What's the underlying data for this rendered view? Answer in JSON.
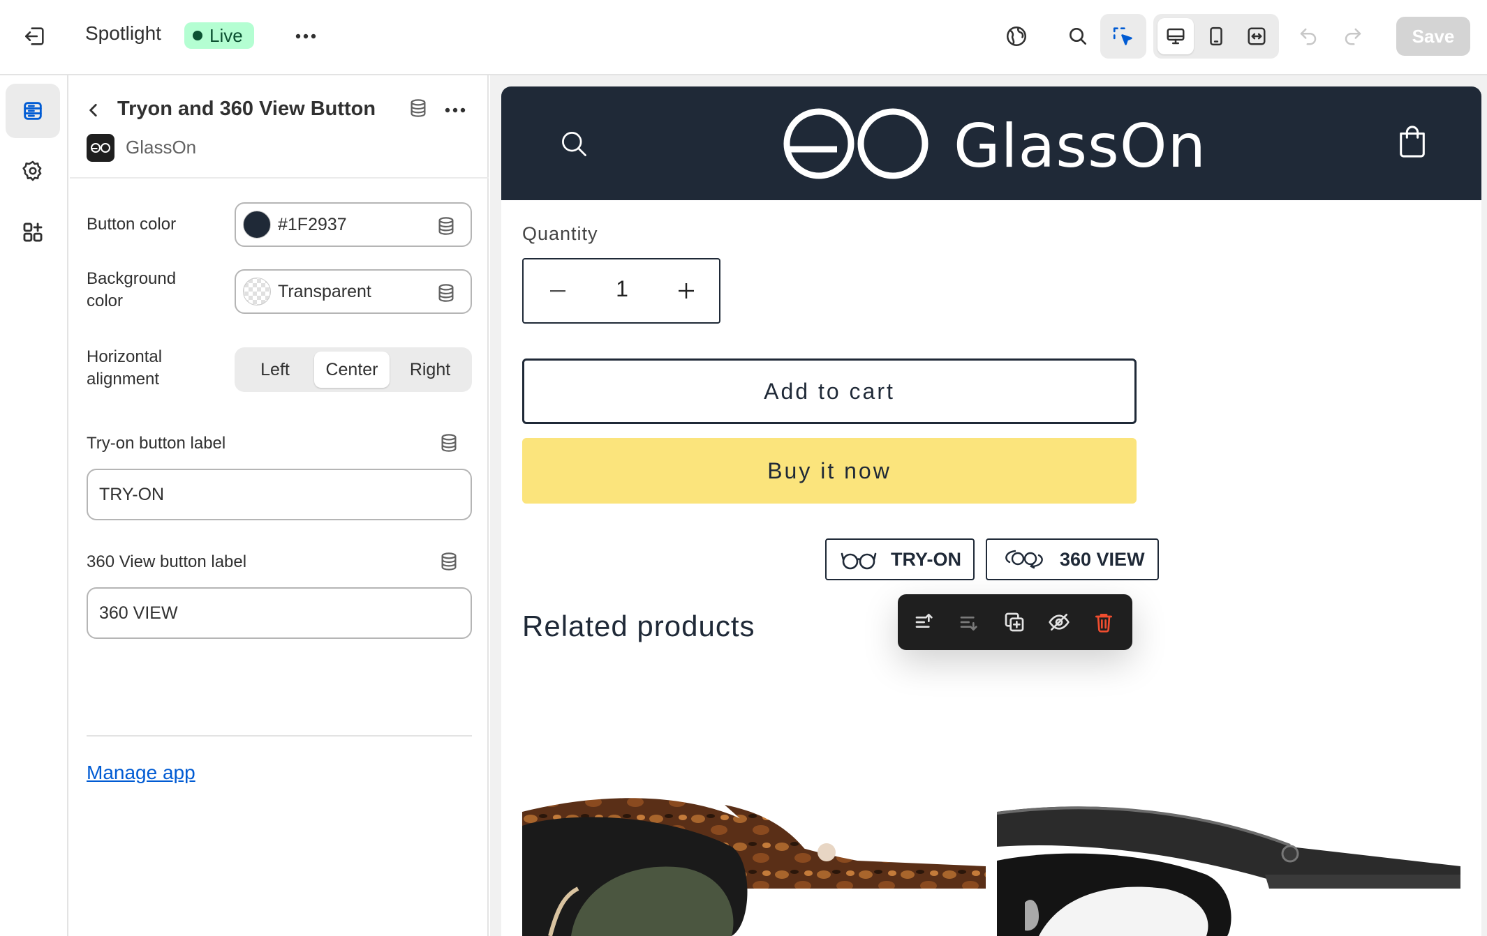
{
  "topbar": {
    "theme_name": "Spotlight",
    "status": "Live",
    "save_label": "Save",
    "colors": {
      "live_bg": "#b4fed2",
      "live_fg": "#0c5132",
      "save_bg": "#d4d4d4"
    }
  },
  "panel": {
    "block_title": "Tryon and 360 View Button",
    "app_name": "GlassOn",
    "button_color": {
      "label": "Button color",
      "value": "#1F2937"
    },
    "background_color": {
      "label": "Background color",
      "value": "Transparent"
    },
    "alignment": {
      "label": "Horizontal alignment",
      "options": [
        "Left",
        "Center",
        "Right"
      ],
      "selected": "Center"
    },
    "tryon_label": {
      "label": "Try-on button label",
      "value": "TRY-ON"
    },
    "view_label": {
      "label": "360 View button label",
      "value": "360 VIEW"
    },
    "manage_link": "Manage app"
  },
  "store": {
    "brand": "GlassOn",
    "quantity_label": "Quantity",
    "quantity": "1",
    "add_to_cart": "Add to cart",
    "buy_now": "Buy it now",
    "tryon_button": "TRY-ON",
    "view_button": "360 VIEW",
    "related": "Related products",
    "colors": {
      "header_bg": "#1F2937",
      "buy_now_bg": "#fbe47c"
    }
  },
  "icons": [
    "exit-icon",
    "more-icon",
    "globe-icon",
    "search-icon",
    "select-icon",
    "desktop-icon",
    "mobile-icon",
    "fullscreen-icon",
    "undo-icon",
    "redo-icon",
    "sections-icon",
    "gear-icon",
    "apps-icon",
    "chevron-left-icon",
    "database-icon",
    "cart-icon",
    "move-up-icon",
    "move-down-icon",
    "duplicate-icon",
    "hide-icon",
    "delete-icon"
  ]
}
